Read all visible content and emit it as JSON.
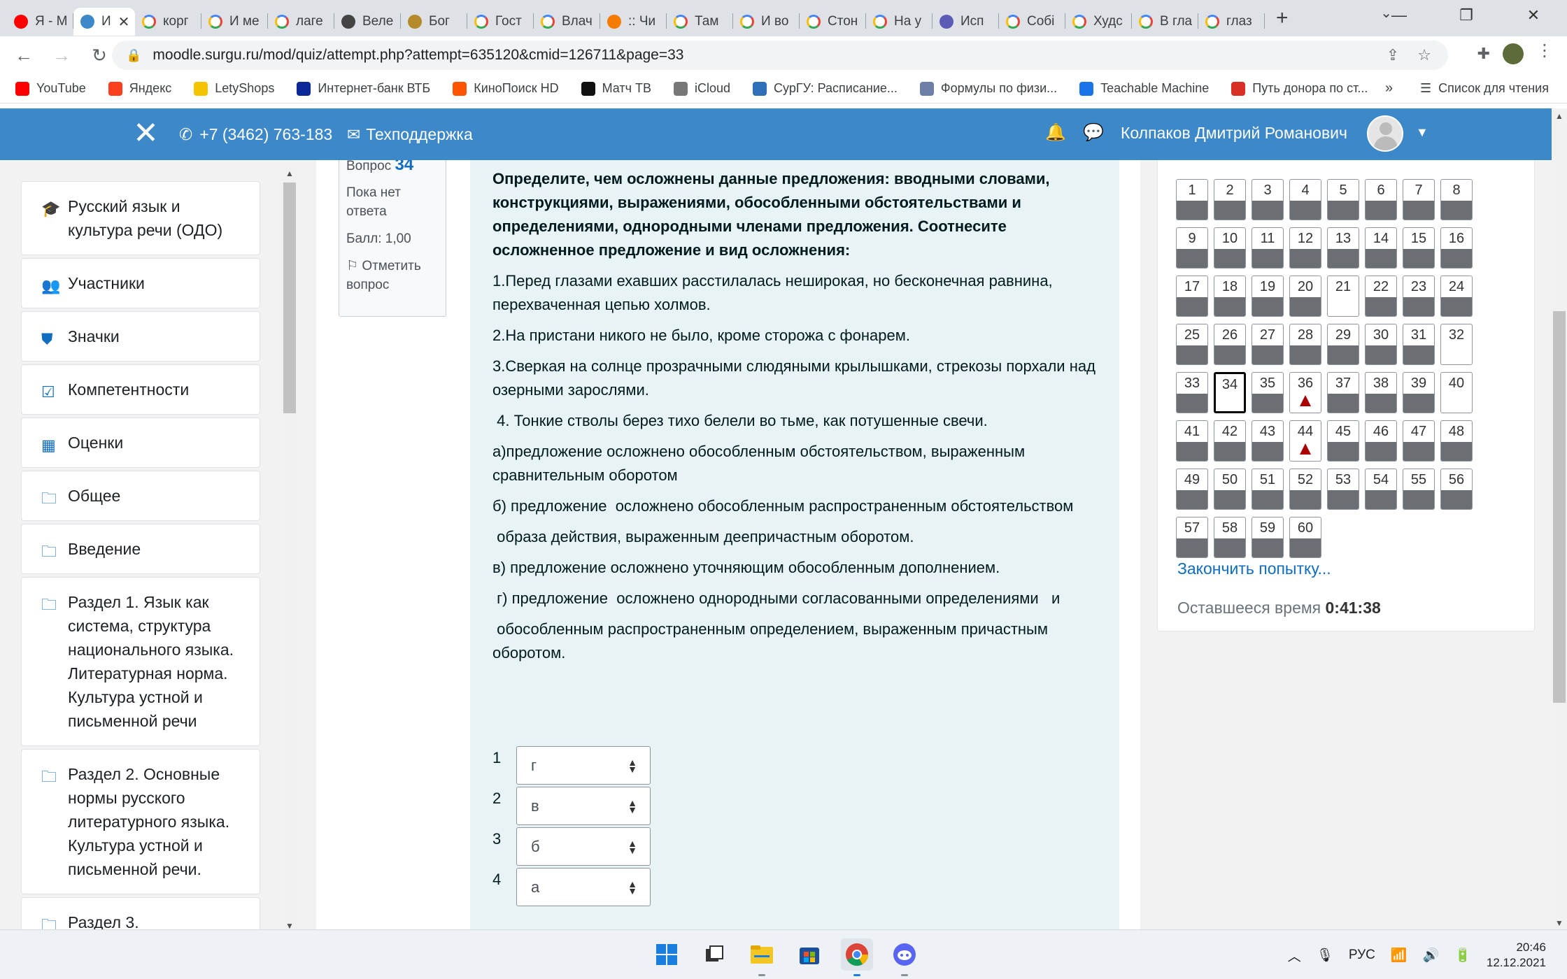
{
  "browser": {
    "tabs": [
      {
        "title": "Я - М",
        "icon": "youtube-icon"
      },
      {
        "title": "И",
        "icon": "moodle-icon",
        "active": true
      },
      {
        "title": "корг",
        "icon": "google-icon"
      },
      {
        "title": "И ме",
        "icon": "google-icon"
      },
      {
        "title": "лаге",
        "icon": "google-icon"
      },
      {
        "title": "Веле",
        "icon": "dict-icon"
      },
      {
        "title": "Бог",
        "icon": "pen-icon"
      },
      {
        "title": "Гост",
        "icon": "google-icon"
      },
      {
        "title": "Влач",
        "icon": "google-icon"
      },
      {
        "title": ":: Чи",
        "icon": "orange-icon"
      },
      {
        "title": "Там",
        "icon": "google-icon"
      },
      {
        "title": "И во",
        "icon": "google-icon"
      },
      {
        "title": "Стон",
        "icon": "google-icon"
      },
      {
        "title": "На у",
        "icon": "google-icon"
      },
      {
        "title": "Исп",
        "icon": "p-icon"
      },
      {
        "title": "Собі",
        "icon": "google-icon"
      },
      {
        "title": "Худс",
        "icon": "google-icon"
      },
      {
        "title": "В гла",
        "icon": "google-icon"
      },
      {
        "title": "глаз",
        "icon": "google-icon"
      }
    ],
    "url": "moodle.surgu.ru/mod/quiz/attempt.php?attempt=635120&cmid=126711&page=33",
    "bookmarks": [
      {
        "label": "YouTube",
        "color": "#ff0000"
      },
      {
        "label": "Яндекс",
        "color": "#fc3f1d"
      },
      {
        "label": "LetyShops",
        "color": "#f5c400"
      },
      {
        "label": "Интернет-банк ВТБ",
        "color": "#0a2896"
      },
      {
        "label": "КиноПоиск HD",
        "color": "#ff5500"
      },
      {
        "label": "Матч ТВ",
        "color": "#111111"
      },
      {
        "label": "iCloud",
        "color": "#777777"
      },
      {
        "label": "СурГУ: Расписание...",
        "color": "#2f6fb8"
      },
      {
        "label": "Формулы по физи...",
        "color": "#6b7fa8"
      },
      {
        "label": "Teachable Machine",
        "color": "#1a73e8"
      },
      {
        "label": "Путь донора по ст...",
        "color": "#d93025"
      }
    ],
    "bookmarks_more": "»",
    "reading_list": "Список для чтения"
  },
  "header": {
    "phone": "+7 (3462) 763-183",
    "support": "Техподдержка",
    "user_name": "Колпаков Дмитрий Романович",
    "color": "#3c88c8"
  },
  "sidebar": {
    "items": [
      {
        "label": "Русский язык и культура речи (ОДО)",
        "icon": "graduation-cap-icon"
      },
      {
        "label": "Участники",
        "icon": "users-icon"
      },
      {
        "label": "Значки",
        "icon": "shield-icon"
      },
      {
        "label": "Компетентности",
        "icon": "checkbox-icon"
      },
      {
        "label": "Оценки",
        "icon": "table-icon"
      },
      {
        "label": "Общее",
        "icon": "folder-icon"
      },
      {
        "label": "Введение",
        "icon": "folder-icon"
      },
      {
        "label": "Раздел 1. Язык как система, структура национального языка. Литературная норма. Культура устной и письменной речи",
        "icon": "folder-icon"
      },
      {
        "label": "Раздел 2. Основные нормы русского литературного языка. Культура устной и письменной речи.",
        "icon": "folder-icon"
      },
      {
        "label": "Раздел 3.",
        "icon": "folder-icon"
      }
    ]
  },
  "question_info": {
    "label": "Вопрос",
    "number": "34",
    "status": "Пока нет ответа",
    "grade": "Балл: 1,00",
    "flag": "Отметить вопрос"
  },
  "question": {
    "prompt": "Определите, чем осложнены данные предложения: вводными словами, конструкциями, выражениями, обособленными обстоятельствами и определениями, однородными членами предложения. Соотнесите  осложненное предложение и вид осложнения:",
    "paragraphs": [
      "1.Перед глазами ехавших расстилалась неширокая, но бесконечная равнина, перехваченная цепью холмов.",
      "2.На пристани никого не было, кроме сторожа с фонарем.",
      "3.Сверкая на солнце прозрачными слюдяными крылышками, стрекозы порхали над    озерными зарослями.",
      " 4. Тонкие стволы берез тихо белели во тьме, как потушенные свечи.",
      "а)предложение осложнено обособленным обстоятельством, выраженным сравнительным оборотом",
      "б) предложение  осложнено обособленным распространенным обстоятельством",
      " образа действия, выраженным деепричастным оборотом.",
      "в) предложение осложнено уточняющим обособленным дополнением.",
      " г) предложение  осложнено однородными согласованными определениями   и",
      " обособленным распространенным определением, выраженным причастным       оборотом."
    ],
    "answers": [
      {
        "num": "1",
        "value": "г"
      },
      {
        "num": "2",
        "value": "в"
      },
      {
        "num": "3",
        "value": "б"
      },
      {
        "num": "4",
        "value": "а"
      }
    ]
  },
  "navigation": {
    "questions": [
      {
        "n": "1",
        "state": "answered"
      },
      {
        "n": "2",
        "state": "answered"
      },
      {
        "n": "3",
        "state": "answered"
      },
      {
        "n": "4",
        "state": "answered"
      },
      {
        "n": "5",
        "state": "answered"
      },
      {
        "n": "6",
        "state": "answered"
      },
      {
        "n": "7",
        "state": "answered"
      },
      {
        "n": "8",
        "state": "answered"
      },
      {
        "n": "9",
        "state": "answered"
      },
      {
        "n": "10",
        "state": "answered"
      },
      {
        "n": "11",
        "state": "answered"
      },
      {
        "n": "12",
        "state": "answered"
      },
      {
        "n": "13",
        "state": "answered"
      },
      {
        "n": "14",
        "state": "answered"
      },
      {
        "n": "15",
        "state": "answered"
      },
      {
        "n": "16",
        "state": "answered"
      },
      {
        "n": "17",
        "state": "answered"
      },
      {
        "n": "18",
        "state": "answered"
      },
      {
        "n": "19",
        "state": "answered"
      },
      {
        "n": "20",
        "state": "answered"
      },
      {
        "n": "21",
        "state": "empty"
      },
      {
        "n": "22",
        "state": "answered"
      },
      {
        "n": "23",
        "state": "answered"
      },
      {
        "n": "24",
        "state": "answered"
      },
      {
        "n": "25",
        "state": "answered"
      },
      {
        "n": "26",
        "state": "answered"
      },
      {
        "n": "27",
        "state": "answered"
      },
      {
        "n": "28",
        "state": "answered"
      },
      {
        "n": "29",
        "state": "answered"
      },
      {
        "n": "30",
        "state": "answered"
      },
      {
        "n": "31",
        "state": "answered"
      },
      {
        "n": "32",
        "state": "empty"
      },
      {
        "n": "33",
        "state": "answered"
      },
      {
        "n": "34",
        "state": "current"
      },
      {
        "n": "35",
        "state": "answered"
      },
      {
        "n": "36",
        "state": "flagged"
      },
      {
        "n": "37",
        "state": "answered"
      },
      {
        "n": "38",
        "state": "answered"
      },
      {
        "n": "39",
        "state": "answered"
      },
      {
        "n": "40",
        "state": "empty"
      },
      {
        "n": "41",
        "state": "answered"
      },
      {
        "n": "42",
        "state": "answered"
      },
      {
        "n": "43",
        "state": "answered"
      },
      {
        "n": "44",
        "state": "flagged"
      },
      {
        "n": "45",
        "state": "answered"
      },
      {
        "n": "46",
        "state": "answered"
      },
      {
        "n": "47",
        "state": "answered"
      },
      {
        "n": "48",
        "state": "answered"
      },
      {
        "n": "49",
        "state": "answered"
      },
      {
        "n": "50",
        "state": "answered"
      },
      {
        "n": "51",
        "state": "answered"
      },
      {
        "n": "52",
        "state": "answered"
      },
      {
        "n": "53",
        "state": "answered"
      },
      {
        "n": "54",
        "state": "answered"
      },
      {
        "n": "55",
        "state": "answered"
      },
      {
        "n": "56",
        "state": "answered"
      },
      {
        "n": "57",
        "state": "answered"
      },
      {
        "n": "58",
        "state": "answered"
      },
      {
        "n": "59",
        "state": "answered"
      },
      {
        "n": "60",
        "state": "answered"
      }
    ],
    "finish_link": "Закончить попытку...",
    "time_label": "Оставшееся время",
    "time_value": "0:41:38"
  },
  "taskbar": {
    "language": "РУС",
    "time": "20:46",
    "date": "12.12.2021"
  }
}
